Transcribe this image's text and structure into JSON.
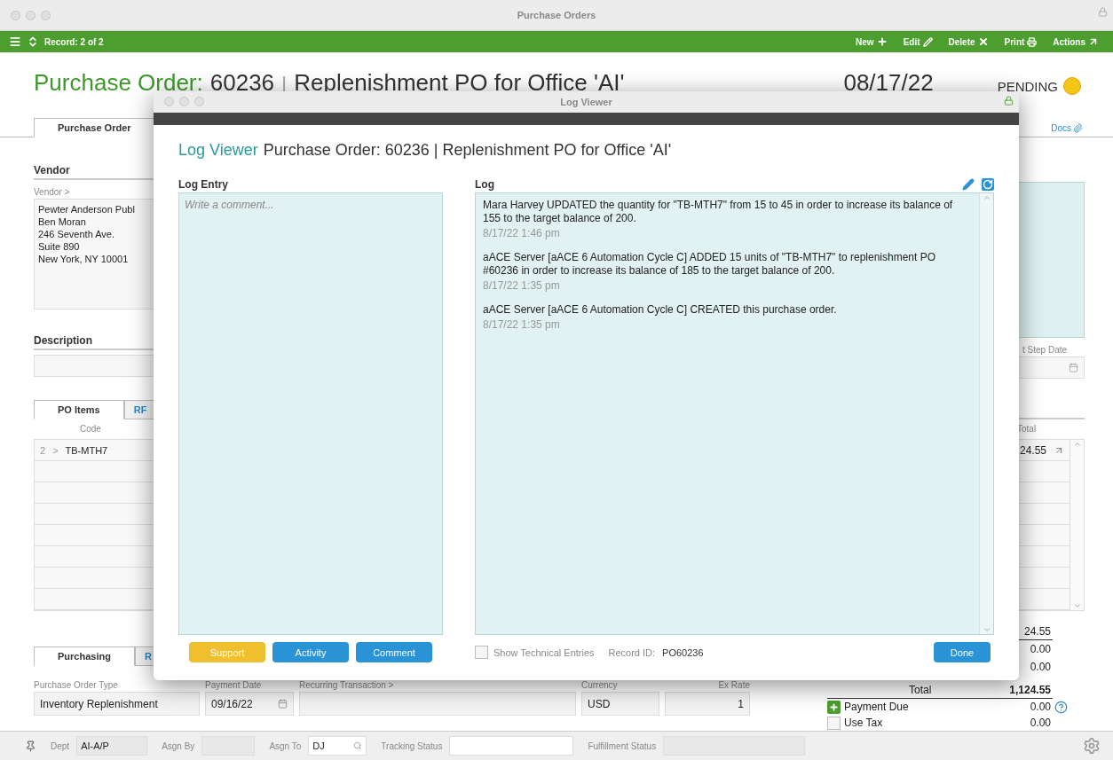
{
  "window": {
    "title": "Purchase Orders"
  },
  "toolbar": {
    "record": "Record: 2 of 2",
    "actions": [
      {
        "label": "New",
        "kind": "new"
      },
      {
        "label": "Edit",
        "kind": "edit"
      },
      {
        "label": "Delete",
        "kind": "delete"
      },
      {
        "label": "Print",
        "kind": "print"
      },
      {
        "label": "Actions",
        "kind": "actions"
      }
    ]
  },
  "header": {
    "label": "Purchase Order:",
    "number": "60236",
    "separator": "|",
    "name": "Replenishment PO for Office 'AI'",
    "date": "08/17/22",
    "status": "PENDING"
  },
  "tabs": [
    {
      "label": "Purchase Order",
      "selected": true
    }
  ],
  "docs_link": "Docs",
  "vendor": {
    "heading": "Vendor",
    "field_label": "Vendor >",
    "address": [
      "Pewter Anderson Publ",
      "Ben Moran",
      "246 Seventh Ave.",
      "Suite 890",
      "New York, NY 10001"
    ]
  },
  "description": {
    "heading": "Description"
  },
  "next_step": {
    "label": "t Step Date"
  },
  "item_tabs": [
    {
      "label": "PO Items",
      "selected": true
    },
    {
      "label": "RF",
      "selected": false
    }
  ],
  "items": {
    "columns": [
      "Code",
      "Total"
    ],
    "rows": [
      {
        "line": "2",
        "marker": ">",
        "code": "TB-MTH7",
        "total": "24.55"
      }
    ]
  },
  "subtotal": "24.55",
  "bottom_tabs": [
    {
      "label": "Purchasing",
      "selected": true
    },
    {
      "label": "R",
      "selected": false
    }
  ],
  "fields": [
    {
      "label": "Purchase Order Type",
      "value": "Inventory Replenishment",
      "kind": "text"
    },
    {
      "label": "Payment Date",
      "value": "09/16/22",
      "kind": "date"
    },
    {
      "label": "Recurring Transaction >",
      "kind": "text"
    },
    {
      "label": "Currency",
      "value": "USD",
      "kind": "text"
    },
    {
      "label": "Ex Rate",
      "value": "1",
      "kind": "number"
    }
  ],
  "totals": {
    "lines": [
      "0.00",
      "0.00"
    ],
    "total_label": "Total",
    "total": "1,124.55",
    "payment_due": {
      "label": "Payment Due",
      "value": "0.00"
    },
    "use_tax": {
      "label": "Use Tax",
      "value": "0.00",
      "checked": false
    }
  },
  "status_bar": [
    {
      "label": "Dept",
      "value": "AI-A/P",
      "kind": "text"
    },
    {
      "label": "Asgn By",
      "kind": "text"
    },
    {
      "label": "Asgn To",
      "value": "DJ",
      "kind": "lookup"
    },
    {
      "label": "Tracking Status",
      "kind": "text"
    },
    {
      "label": "Fulfillment Status",
      "kind": "text"
    }
  ],
  "log_viewer": {
    "title": "Log Viewer",
    "heading": "Log Viewer",
    "subheading": "Purchase Order: 60236 | Replenishment PO for Office 'AI'",
    "entry_label": "Log Entry",
    "entry_placeholder": "Write a comment...",
    "buttons": [
      {
        "label": "Support",
        "kind": "support"
      },
      {
        "label": "Activity",
        "kind": "primary"
      },
      {
        "label": "Comment",
        "kind": "primary"
      }
    ],
    "log_label": "Log",
    "entries": [
      {
        "text": "Mara Harvey UPDATED the quantity for \"TB-MTH7\" from 15 to 45 in order to increase its balance of 155 to the target balance of 200.",
        "time": "8/17/22  1:46 pm"
      },
      {
        "text": "aACE Server [aACE 6 Automation Cycle C] ADDED 15 units of \"TB-MTH7\" to replenishment PO #60236 in order to increase its balance of 185 to the target balance of 200.",
        "time": "8/17/22  1:35 pm"
      },
      {
        "text": "aACE Server [aACE 6 Automation Cycle C] CREATED this purchase order.",
        "time": "8/17/22  1:35 pm"
      }
    ],
    "show_technical": {
      "label": "Show Technical Entries",
      "checked": false
    },
    "record_label": "Record ID:",
    "record_id": "PO60236",
    "done": "Done"
  }
}
